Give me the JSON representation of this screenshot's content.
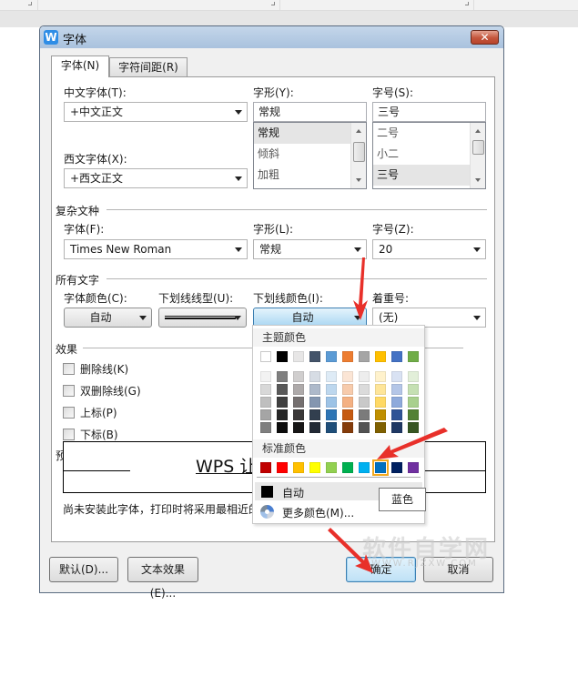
{
  "dialog": {
    "title": "字体",
    "app_icon": "W",
    "close_label": "✕",
    "tabs": [
      {
        "label": "字体(N)",
        "active": true
      },
      {
        "label": "字符间距(R)",
        "active": false
      }
    ]
  },
  "chinese_font": {
    "label": "中文字体(T):",
    "value": "+中文正文"
  },
  "western_font": {
    "label": "西文字体(X):",
    "value": "+西文正文"
  },
  "style": {
    "label": "字形(Y):",
    "value": "常规",
    "options": [
      {
        "label": "常规",
        "selected": true
      },
      {
        "label": "倾斜",
        "selected": false
      },
      {
        "label": "加粗",
        "selected": false
      }
    ]
  },
  "size": {
    "label": "字号(S):",
    "value": "三号",
    "options": [
      {
        "label": "二号",
        "selected": false
      },
      {
        "label": "小二",
        "selected": false
      },
      {
        "label": "三号",
        "selected": true
      }
    ]
  },
  "complex": {
    "group_title": "复杂文种",
    "font_label": "字体(F):",
    "font_value": "Times New Roman",
    "style_label": "字形(L):",
    "style_value": "常规",
    "size_label": "字号(Z):",
    "size_value": "20"
  },
  "all_text": {
    "group_title": "所有文字",
    "font_color_label": "字体颜色(C):",
    "font_color_value": "自动",
    "underline_type_label": "下划线线型(U):",
    "underline_color_label": "下划线颜色(I):",
    "underline_color_value": "自动",
    "emphasis_label": "着重号:",
    "emphasis_value": "(无)"
  },
  "effects": {
    "group_title": "效果",
    "items": [
      {
        "label": "删除线(K)",
        "checked": false
      },
      {
        "label": "双删除线(G)",
        "checked": false
      },
      {
        "label": "上标(P)",
        "checked": false
      },
      {
        "label": "下标(B)",
        "checked": false
      }
    ]
  },
  "preview": {
    "group_title": "预览",
    "text": "WPS 让"
  },
  "notice": "尚未安装此字体，打印时将采用最相近的有效字体。",
  "buttons": {
    "default": "默认(D)...",
    "text_effect": "文本效果(E)...",
    "ok": "确定",
    "cancel": "取消"
  },
  "color_popup": {
    "theme_title": "主题颜色",
    "theme_row": [
      "#ffffff",
      "#000000",
      "#e7e6e6",
      "#44546a",
      "#5b9bd5",
      "#ed7d31",
      "#a5a5a5",
      "#ffc000",
      "#4472c4",
      "#70ad47"
    ],
    "theme_shades": [
      [
        "#f2f2f2",
        "#7f7f7f",
        "#d0cece",
        "#d6dce4",
        "#deebf6",
        "#fbe5d5",
        "#ededed",
        "#fff2cc",
        "#d9e2f3",
        "#e2efd9"
      ],
      [
        "#d8d8d8",
        "#595959",
        "#aeaaaa",
        "#adb9ca",
        "#bdd7ee",
        "#f7cbac",
        "#dbdbdb",
        "#fee599",
        "#b4c6e7",
        "#c5e0b3"
      ],
      [
        "#bfbfbf",
        "#3f3f3f",
        "#757070",
        "#8496b0",
        "#9dc3e6",
        "#f4b183",
        "#c9c9c9",
        "#ffd965",
        "#8eaadb",
        "#a8d08d"
      ],
      [
        "#a5a5a5",
        "#262626",
        "#3a3838",
        "#323f4f",
        "#2e75b5",
        "#c55a11",
        "#7b7b7b",
        "#bf8f00",
        "#2f5496",
        "#538135"
      ],
      [
        "#7f7f7f",
        "#0c0c0c",
        "#171616",
        "#222a35",
        "#1f4e79",
        "#843c0b",
        "#525252",
        "#7f6000",
        "#1f3864",
        "#375623"
      ]
    ],
    "standard_title": "标准颜色",
    "standard_row": [
      "#c00000",
      "#ff0000",
      "#ffc000",
      "#ffff00",
      "#92d050",
      "#00b050",
      "#00b0f0",
      "#0070c0",
      "#002060",
      "#7030a0"
    ],
    "standard_selected_index": 7,
    "auto_label": "自动",
    "more_label": "更多颜色(M)...",
    "tooltip": "蓝色"
  },
  "watermark": {
    "main": "软件自学网",
    "sub": "WWW.RJZXW.COM"
  },
  "annotation_color": "#e8302a"
}
